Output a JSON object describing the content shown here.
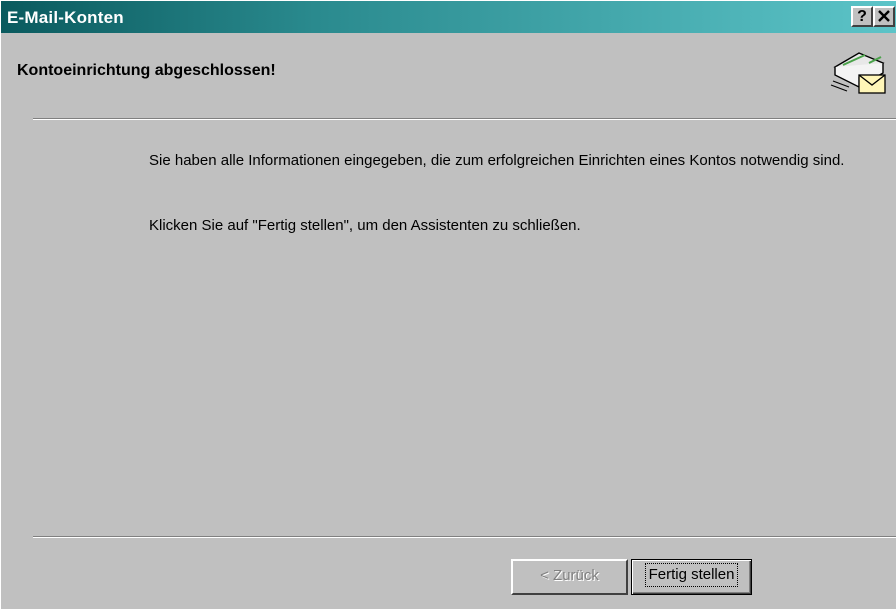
{
  "window": {
    "title": "E-Mail-Konten",
    "help_button": "?",
    "close_button": "✕"
  },
  "header": {
    "heading": "Kontoeinrichtung abgeschlossen!",
    "icon": "mail-envelope-icon"
  },
  "content": {
    "paragraph_1": "Sie haben alle Informationen eingegeben, die zum erfolgreichen Einrichten eines Kontos notwendig sind.",
    "paragraph_2": "Klicken Sie auf \"Fertig stellen\", um den Assistenten zu schließen."
  },
  "buttons": {
    "back_label": "< Zurück",
    "finish_label": "Fertig stellen"
  },
  "colors": {
    "titlebar_start": "#0a5a5e",
    "titlebar_end": "#5cc4c8",
    "dialog_bg": "#c0c0c0"
  }
}
